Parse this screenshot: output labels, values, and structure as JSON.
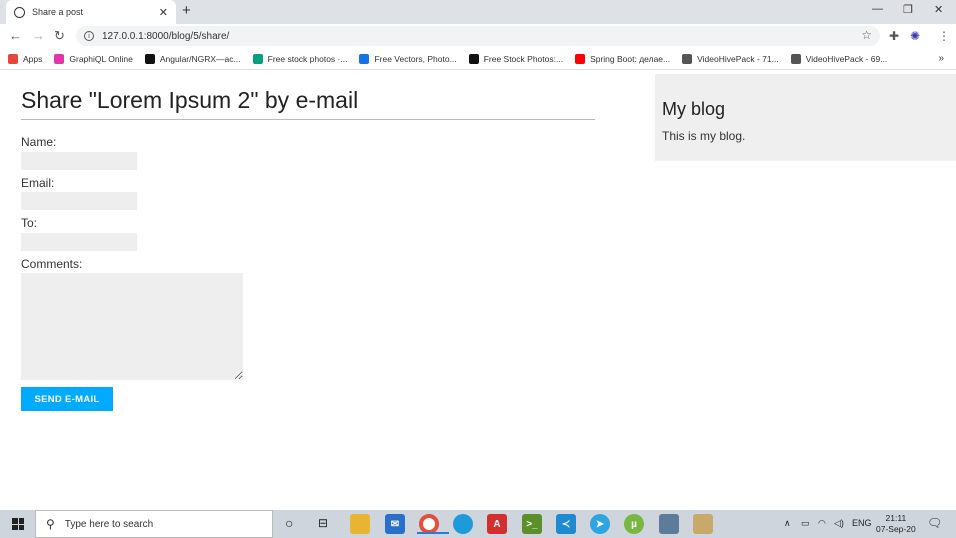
{
  "browser": {
    "tab_title": "Share a post",
    "tab_close": "✕",
    "new_tab": "+",
    "url": "127.0.0.1:8000/blog/5/share/",
    "minimize": "—",
    "restore": "❐",
    "close": "✕"
  },
  "bookmarks": [
    {
      "label": "Apps",
      "icon": "apps-icon",
      "color": "#e8453c"
    },
    {
      "label": "GraphiQL Online",
      "icon": "graphql-icon",
      "color": "#e535ab"
    },
    {
      "label": "Angular/NGRX—ас...",
      "icon": "medium-icon",
      "color": "#111111"
    },
    {
      "label": "Free stock photos ·...",
      "icon": "pexels-icon",
      "color": "#05a081"
    },
    {
      "label": "Free Vectors, Photo...",
      "icon": "freepik-icon",
      "color": "#1273eb"
    },
    {
      "label": "Free Stock Photos:...",
      "icon": "burst-icon",
      "color": "#111111"
    },
    {
      "label": "Spring Boot: делае...",
      "icon": "youtube-icon",
      "color": "#ff0000"
    },
    {
      "label": "VideoHivePack - 71...",
      "icon": "videohive-icon",
      "color": "#555555"
    },
    {
      "label": "VideoHivePack - 69...",
      "icon": "videohive-icon",
      "color": "#555555"
    }
  ],
  "bookmarks_more": "»",
  "page": {
    "heading": "Share \"Lorem Ipsum 2\" by e-mail",
    "fields": {
      "name_label": "Name:",
      "email_label": "Email:",
      "to_label": "To:",
      "comments_label": "Comments:"
    },
    "submit_label": "SEND E-MAIL"
  },
  "sidebar": {
    "title": "My blog",
    "text": "This is my blog."
  },
  "taskbar": {
    "search_placeholder": "Type here to search",
    "language": "ENG",
    "time": "21:11",
    "date": "07-Sep-20"
  },
  "colors": {
    "accent": "#00abff",
    "sidebar_bg": "#efefef"
  }
}
